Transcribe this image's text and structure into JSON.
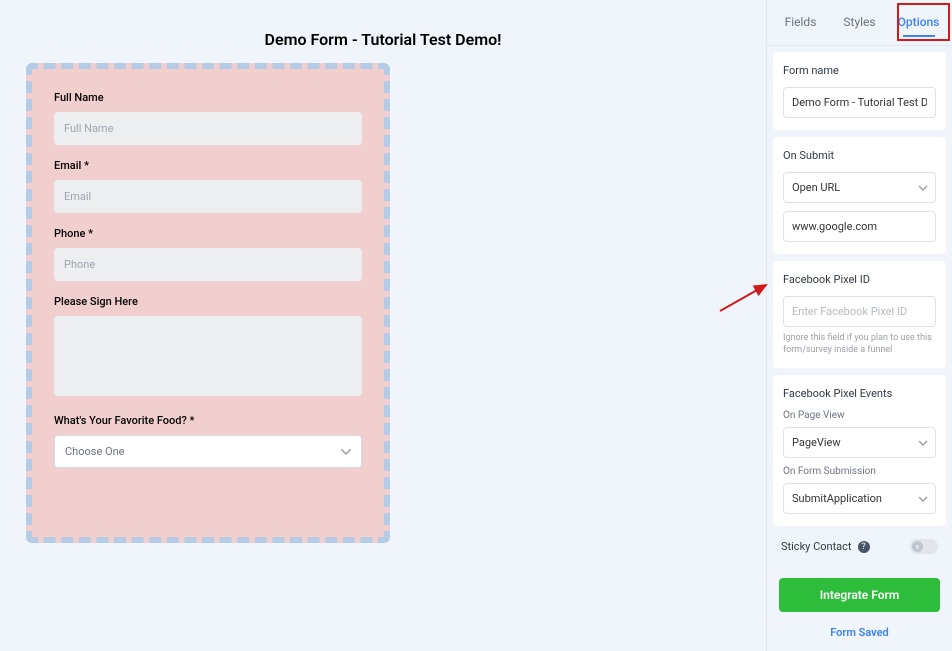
{
  "form": {
    "title": "Demo Form - Tutorial Test Demo!",
    "fields": {
      "full_name": {
        "label": "Full Name",
        "placeholder": "Full Name"
      },
      "email": {
        "label": "Email *",
        "placeholder": "Email"
      },
      "phone": {
        "label": "Phone *",
        "placeholder": "Phone"
      },
      "sign": {
        "label": "Please Sign Here"
      },
      "fav_food": {
        "label": "What's Your Favorite Food? *",
        "placeholder": "Choose One"
      }
    }
  },
  "sidebar": {
    "tabs": {
      "fields": "Fields",
      "styles": "Styles",
      "options": "Options"
    },
    "form_name": {
      "label": "Form name",
      "value": "Demo Form - Tutorial Test Demo!"
    },
    "on_submit": {
      "label": "On Submit",
      "action": "Open URL",
      "url": "www.google.com"
    },
    "fb_pixel": {
      "label": "Facebook Pixel ID",
      "placeholder": "Enter Facebook Pixel ID",
      "helper": "Ignore this field if you plan to use this form/survey inside a funnel"
    },
    "fb_events": {
      "label": "Facebook Pixel Events",
      "page_view_label": "On Page View",
      "page_view_value": "PageView",
      "submit_label": "On Form Submission",
      "submit_value": "SubmitApplication"
    },
    "sticky": {
      "label": "Sticky Contact",
      "help": "?",
      "knob": "x"
    },
    "buttons": {
      "integrate": "Integrate Form",
      "saved": "Form Saved"
    }
  }
}
